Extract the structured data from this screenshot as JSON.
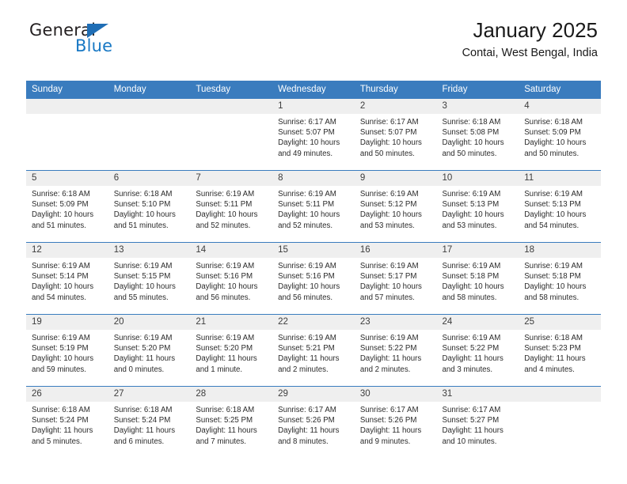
{
  "brand": {
    "name_top": "General",
    "name_bottom": "Blue",
    "color_dark": "#231f20",
    "color_blue": "#1878c4"
  },
  "header": {
    "title": "January 2025",
    "subtitle": "Contai, West Bengal, India"
  },
  "theme": {
    "header_row_bg": "#3a7cbe",
    "daynum_bg": "#efefef",
    "grid_line": "#3a7cbe"
  },
  "calendar": {
    "weekday_headers": [
      "Sunday",
      "Monday",
      "Tuesday",
      "Wednesday",
      "Thursday",
      "Friday",
      "Saturday"
    ],
    "labels": {
      "sunrise": "Sunrise:",
      "sunset": "Sunset:",
      "daylight": "Daylight:"
    },
    "weeks": [
      [
        {
          "day": "",
          "empty": true,
          "sunrise": "",
          "sunset": "",
          "daylight_1": "",
          "daylight_2": ""
        },
        {
          "day": "",
          "empty": true,
          "sunrise": "",
          "sunset": "",
          "daylight_1": "",
          "daylight_2": ""
        },
        {
          "day": "",
          "empty": true,
          "sunrise": "",
          "sunset": "",
          "daylight_1": "",
          "daylight_2": ""
        },
        {
          "day": "1",
          "empty": false,
          "sunrise": "Sunrise: 6:17 AM",
          "sunset": "Sunset: 5:07 PM",
          "daylight_1": "Daylight: 10 hours",
          "daylight_2": "and 49 minutes."
        },
        {
          "day": "2",
          "empty": false,
          "sunrise": "Sunrise: 6:17 AM",
          "sunset": "Sunset: 5:07 PM",
          "daylight_1": "Daylight: 10 hours",
          "daylight_2": "and 50 minutes."
        },
        {
          "day": "3",
          "empty": false,
          "sunrise": "Sunrise: 6:18 AM",
          "sunset": "Sunset: 5:08 PM",
          "daylight_1": "Daylight: 10 hours",
          "daylight_2": "and 50 minutes."
        },
        {
          "day": "4",
          "empty": false,
          "sunrise": "Sunrise: 6:18 AM",
          "sunset": "Sunset: 5:09 PM",
          "daylight_1": "Daylight: 10 hours",
          "daylight_2": "and 50 minutes."
        }
      ],
      [
        {
          "day": "5",
          "empty": false,
          "sunrise": "Sunrise: 6:18 AM",
          "sunset": "Sunset: 5:09 PM",
          "daylight_1": "Daylight: 10 hours",
          "daylight_2": "and 51 minutes."
        },
        {
          "day": "6",
          "empty": false,
          "sunrise": "Sunrise: 6:18 AM",
          "sunset": "Sunset: 5:10 PM",
          "daylight_1": "Daylight: 10 hours",
          "daylight_2": "and 51 minutes."
        },
        {
          "day": "7",
          "empty": false,
          "sunrise": "Sunrise: 6:19 AM",
          "sunset": "Sunset: 5:11 PM",
          "daylight_1": "Daylight: 10 hours",
          "daylight_2": "and 52 minutes."
        },
        {
          "day": "8",
          "empty": false,
          "sunrise": "Sunrise: 6:19 AM",
          "sunset": "Sunset: 5:11 PM",
          "daylight_1": "Daylight: 10 hours",
          "daylight_2": "and 52 minutes."
        },
        {
          "day": "9",
          "empty": false,
          "sunrise": "Sunrise: 6:19 AM",
          "sunset": "Sunset: 5:12 PM",
          "daylight_1": "Daylight: 10 hours",
          "daylight_2": "and 53 minutes."
        },
        {
          "day": "10",
          "empty": false,
          "sunrise": "Sunrise: 6:19 AM",
          "sunset": "Sunset: 5:13 PM",
          "daylight_1": "Daylight: 10 hours",
          "daylight_2": "and 53 minutes."
        },
        {
          "day": "11",
          "empty": false,
          "sunrise": "Sunrise: 6:19 AM",
          "sunset": "Sunset: 5:13 PM",
          "daylight_1": "Daylight: 10 hours",
          "daylight_2": "and 54 minutes."
        }
      ],
      [
        {
          "day": "12",
          "empty": false,
          "sunrise": "Sunrise: 6:19 AM",
          "sunset": "Sunset: 5:14 PM",
          "daylight_1": "Daylight: 10 hours",
          "daylight_2": "and 54 minutes."
        },
        {
          "day": "13",
          "empty": false,
          "sunrise": "Sunrise: 6:19 AM",
          "sunset": "Sunset: 5:15 PM",
          "daylight_1": "Daylight: 10 hours",
          "daylight_2": "and 55 minutes."
        },
        {
          "day": "14",
          "empty": false,
          "sunrise": "Sunrise: 6:19 AM",
          "sunset": "Sunset: 5:16 PM",
          "daylight_1": "Daylight: 10 hours",
          "daylight_2": "and 56 minutes."
        },
        {
          "day": "15",
          "empty": false,
          "sunrise": "Sunrise: 6:19 AM",
          "sunset": "Sunset: 5:16 PM",
          "daylight_1": "Daylight: 10 hours",
          "daylight_2": "and 56 minutes."
        },
        {
          "day": "16",
          "empty": false,
          "sunrise": "Sunrise: 6:19 AM",
          "sunset": "Sunset: 5:17 PM",
          "daylight_1": "Daylight: 10 hours",
          "daylight_2": "and 57 minutes."
        },
        {
          "day": "17",
          "empty": false,
          "sunrise": "Sunrise: 6:19 AM",
          "sunset": "Sunset: 5:18 PM",
          "daylight_1": "Daylight: 10 hours",
          "daylight_2": "and 58 minutes."
        },
        {
          "day": "18",
          "empty": false,
          "sunrise": "Sunrise: 6:19 AM",
          "sunset": "Sunset: 5:18 PM",
          "daylight_1": "Daylight: 10 hours",
          "daylight_2": "and 58 minutes."
        }
      ],
      [
        {
          "day": "19",
          "empty": false,
          "sunrise": "Sunrise: 6:19 AM",
          "sunset": "Sunset: 5:19 PM",
          "daylight_1": "Daylight: 10 hours",
          "daylight_2": "and 59 minutes."
        },
        {
          "day": "20",
          "empty": false,
          "sunrise": "Sunrise: 6:19 AM",
          "sunset": "Sunset: 5:20 PM",
          "daylight_1": "Daylight: 11 hours",
          "daylight_2": "and 0 minutes."
        },
        {
          "day": "21",
          "empty": false,
          "sunrise": "Sunrise: 6:19 AM",
          "sunset": "Sunset: 5:20 PM",
          "daylight_1": "Daylight: 11 hours",
          "daylight_2": "and 1 minute."
        },
        {
          "day": "22",
          "empty": false,
          "sunrise": "Sunrise: 6:19 AM",
          "sunset": "Sunset: 5:21 PM",
          "daylight_1": "Daylight: 11 hours",
          "daylight_2": "and 2 minutes."
        },
        {
          "day": "23",
          "empty": false,
          "sunrise": "Sunrise: 6:19 AM",
          "sunset": "Sunset: 5:22 PM",
          "daylight_1": "Daylight: 11 hours",
          "daylight_2": "and 2 minutes."
        },
        {
          "day": "24",
          "empty": false,
          "sunrise": "Sunrise: 6:19 AM",
          "sunset": "Sunset: 5:22 PM",
          "daylight_1": "Daylight: 11 hours",
          "daylight_2": "and 3 minutes."
        },
        {
          "day": "25",
          "empty": false,
          "sunrise": "Sunrise: 6:18 AM",
          "sunset": "Sunset: 5:23 PM",
          "daylight_1": "Daylight: 11 hours",
          "daylight_2": "and 4 minutes."
        }
      ],
      [
        {
          "day": "26",
          "empty": false,
          "sunrise": "Sunrise: 6:18 AM",
          "sunset": "Sunset: 5:24 PM",
          "daylight_1": "Daylight: 11 hours",
          "daylight_2": "and 5 minutes."
        },
        {
          "day": "27",
          "empty": false,
          "sunrise": "Sunrise: 6:18 AM",
          "sunset": "Sunset: 5:24 PM",
          "daylight_1": "Daylight: 11 hours",
          "daylight_2": "and 6 minutes."
        },
        {
          "day": "28",
          "empty": false,
          "sunrise": "Sunrise: 6:18 AM",
          "sunset": "Sunset: 5:25 PM",
          "daylight_1": "Daylight: 11 hours",
          "daylight_2": "and 7 minutes."
        },
        {
          "day": "29",
          "empty": false,
          "sunrise": "Sunrise: 6:17 AM",
          "sunset": "Sunset: 5:26 PM",
          "daylight_1": "Daylight: 11 hours",
          "daylight_2": "and 8 minutes."
        },
        {
          "day": "30",
          "empty": false,
          "sunrise": "Sunrise: 6:17 AM",
          "sunset": "Sunset: 5:26 PM",
          "daylight_1": "Daylight: 11 hours",
          "daylight_2": "and 9 minutes."
        },
        {
          "day": "31",
          "empty": false,
          "sunrise": "Sunrise: 6:17 AM",
          "sunset": "Sunset: 5:27 PM",
          "daylight_1": "Daylight: 11 hours",
          "daylight_2": "and 10 minutes."
        },
        {
          "day": "",
          "empty": true,
          "sunrise": "",
          "sunset": "",
          "daylight_1": "",
          "daylight_2": ""
        }
      ]
    ]
  }
}
